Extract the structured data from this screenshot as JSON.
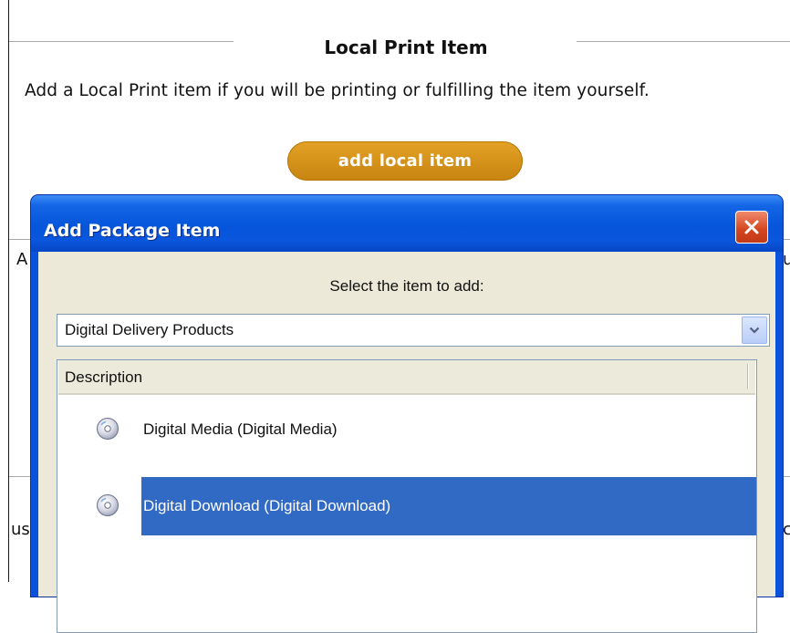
{
  "page": {
    "section_title": "Local Print Item",
    "section_description": "Add a Local Print item if you will be printing or fulfilling the item yourself.",
    "add_button_label": "add local item",
    "accent_color": "#d4911a",
    "edge_fragments": {
      "left_1": "A",
      "right_1": "u",
      "left_2": "us",
      "right_2": "c"
    }
  },
  "dialog": {
    "title": "Add Package Item",
    "close_icon": "close-x-icon",
    "select_label": "Select the item to add:",
    "select_value": "Digital Delivery Products",
    "list": {
      "column_header": "Description",
      "items": [
        {
          "label": "Digital Media (Digital Media)",
          "icon": "disc-icon",
          "selected": false
        },
        {
          "label": "Digital Download (Digital Download)",
          "icon": "disc-icon",
          "selected": true
        }
      ]
    },
    "colors": {
      "titlebar": "#0a56dc",
      "body": "#ece9d8",
      "selection": "#316ac5",
      "close_button": "#d4441e"
    }
  }
}
